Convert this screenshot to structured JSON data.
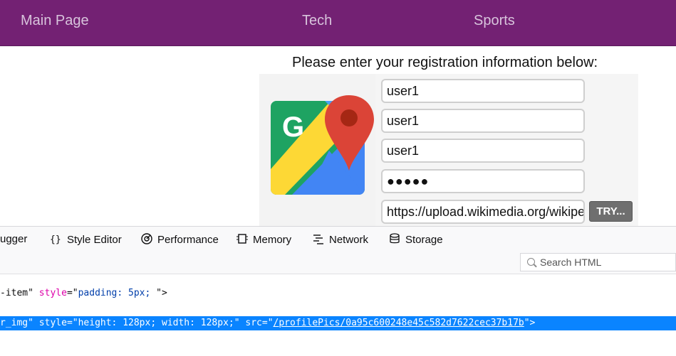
{
  "nav": {
    "items": [
      {
        "label": "Main Page"
      },
      {
        "label": "Tech"
      },
      {
        "label": "Sports"
      }
    ]
  },
  "form": {
    "heading": "Please enter your registration information below:",
    "fields": [
      {
        "value": "user1"
      },
      {
        "value": "user1"
      },
      {
        "value": "user1"
      },
      {
        "value": "●●●●●"
      },
      {
        "value": "https://upload.wikimedia.org/wikipe"
      }
    ],
    "try_label": "TRY..."
  },
  "devtools": {
    "tabs": [
      {
        "label": "ugger",
        "icon": "debugger-icon"
      },
      {
        "label": "Style Editor",
        "icon": "style-editor-icon"
      },
      {
        "label": "Performance",
        "icon": "performance-icon"
      },
      {
        "label": "Memory",
        "icon": "memory-icon"
      },
      {
        "label": "Network",
        "icon": "network-icon"
      },
      {
        "label": "Storage",
        "icon": "storage-icon"
      }
    ],
    "search_placeholder": "Search HTML",
    "code_line1": {
      "prefix": "-item\" ",
      "attr": "style",
      "eq": "=\"",
      "val": "padding: 5px; ",
      "suffix": "\">"
    },
    "code_line2": {
      "prefix": "r_img\" ",
      "attr1": "style",
      "val1": "=\"height: 128px; width: 128px;\" ",
      "attr2": "src",
      "eq2": "=\"",
      "link": "/profilePics/0a95c600248e45c582d7622cec37b17b",
      "suffix": "\">"
    }
  },
  "colors": {
    "nav_bg": "#732173",
    "selection": "#0a84ff"
  }
}
